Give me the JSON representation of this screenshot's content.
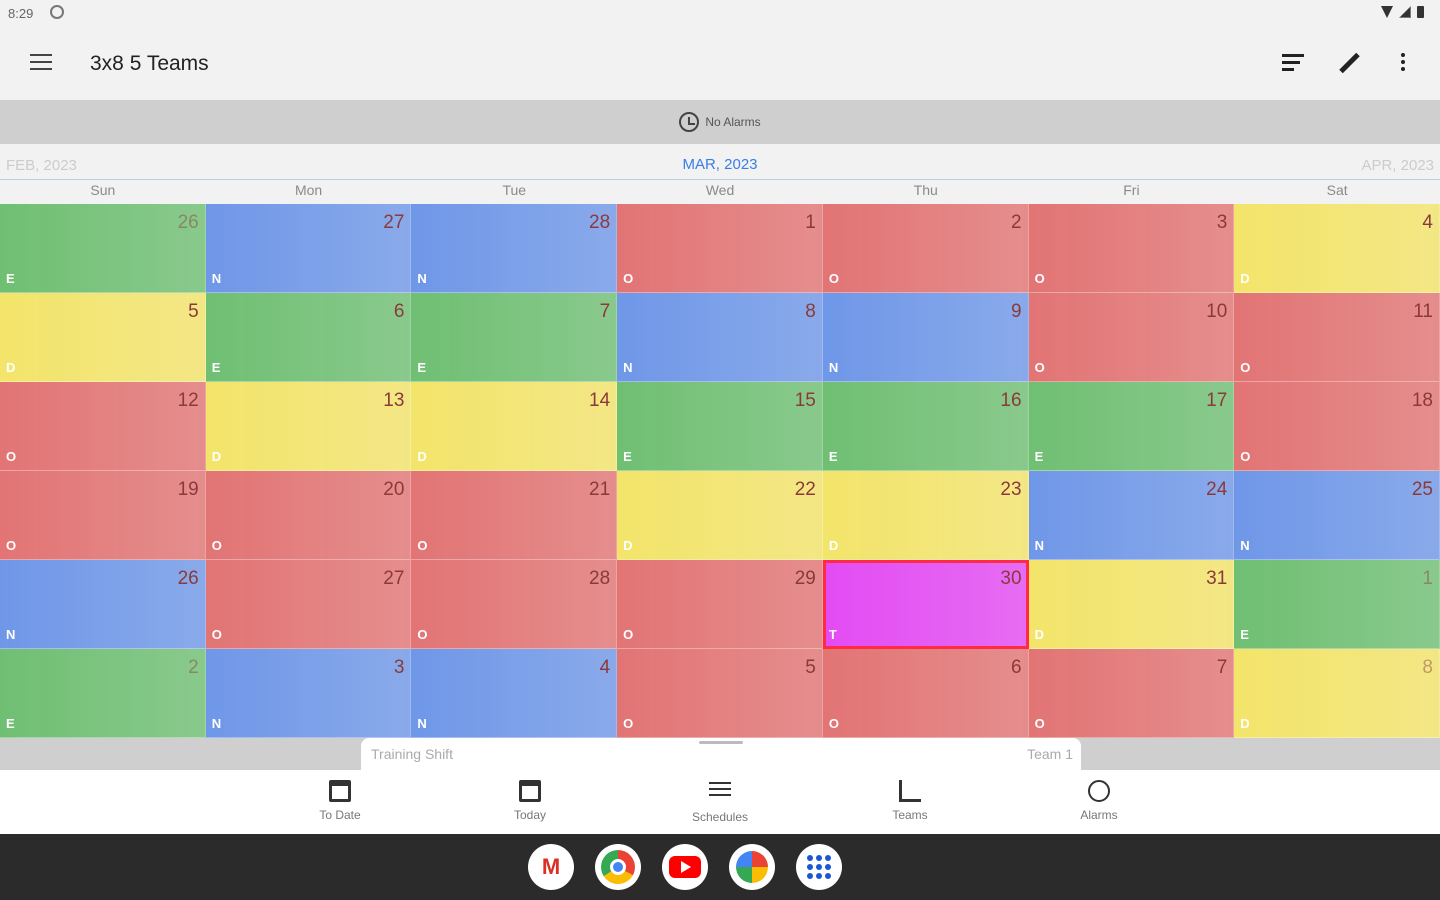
{
  "status": {
    "time": "8:29"
  },
  "app": {
    "title": "3x8 5 Teams"
  },
  "toolbar": {
    "icons": [
      "menu-icon",
      "sort-icon",
      "edit-icon",
      "more-vert-icon"
    ]
  },
  "alarm_strip": {
    "label": "No Alarms",
    "icon": "alarm-icon"
  },
  "months": {
    "prev": "FEB, 2023",
    "current": "MAR, 2023",
    "next": "APR, 2023"
  },
  "weekdays": [
    "Sun",
    "Mon",
    "Tue",
    "Wed",
    "Thu",
    "Fri",
    "Sat"
  ],
  "colors": {
    "E": "#6fbf73",
    "N": "#6f97e8",
    "O": "#e27474",
    "D": "#f3e46a",
    "T": "#e34bf3",
    "today_outline": "#ff2b46"
  },
  "days": [
    {
      "num": "26",
      "code": "E",
      "other": true
    },
    {
      "num": "27",
      "code": "N"
    },
    {
      "num": "28",
      "code": "N"
    },
    {
      "num": "1",
      "code": "O"
    },
    {
      "num": "2",
      "code": "O"
    },
    {
      "num": "3",
      "code": "O"
    },
    {
      "num": "4",
      "code": "D"
    },
    {
      "num": "5",
      "code": "D"
    },
    {
      "num": "6",
      "code": "E"
    },
    {
      "num": "7",
      "code": "E"
    },
    {
      "num": "8",
      "code": "N"
    },
    {
      "num": "9",
      "code": "N"
    },
    {
      "num": "10",
      "code": "O"
    },
    {
      "num": "11",
      "code": "O"
    },
    {
      "num": "12",
      "code": "O"
    },
    {
      "num": "13",
      "code": "D"
    },
    {
      "num": "14",
      "code": "D"
    },
    {
      "num": "15",
      "code": "E"
    },
    {
      "num": "16",
      "code": "E"
    },
    {
      "num": "17",
      "code": "E"
    },
    {
      "num": "18",
      "code": "O"
    },
    {
      "num": "19",
      "code": "O"
    },
    {
      "num": "20",
      "code": "O"
    },
    {
      "num": "21",
      "code": "O"
    },
    {
      "num": "22",
      "code": "D"
    },
    {
      "num": "23",
      "code": "D"
    },
    {
      "num": "24",
      "code": "N"
    },
    {
      "num": "25",
      "code": "N"
    },
    {
      "num": "26",
      "code": "N"
    },
    {
      "num": "27",
      "code": "O"
    },
    {
      "num": "28",
      "code": "O"
    },
    {
      "num": "29",
      "code": "O"
    },
    {
      "num": "30",
      "code": "T",
      "today": true
    },
    {
      "num": "31",
      "code": "D"
    },
    {
      "num": "1",
      "code": "E",
      "other": true
    },
    {
      "num": "2",
      "code": "E",
      "other": true
    },
    {
      "num": "3",
      "code": "N"
    },
    {
      "num": "4",
      "code": "N"
    },
    {
      "num": "5",
      "code": "O"
    },
    {
      "num": "6",
      "code": "O"
    },
    {
      "num": "7",
      "code": "O"
    },
    {
      "num": "8",
      "code": "D",
      "other": true
    }
  ],
  "bottom_sheet": {
    "left": "Training Shift",
    "right": "Team 1"
  },
  "nav": [
    {
      "label": "To Date",
      "icon": "calendar-arrow-icon"
    },
    {
      "label": "Today",
      "icon": "today-icon"
    },
    {
      "label": "Schedules",
      "icon": "list-icon"
    },
    {
      "label": "Teams",
      "icon": "teams-icon"
    },
    {
      "label": "Alarms",
      "icon": "alarm-icon"
    }
  ],
  "taskbar": {
    "apps": [
      "gmail-icon",
      "chrome-icon",
      "youtube-icon",
      "photos-icon",
      "app-drawer-icon"
    ]
  }
}
